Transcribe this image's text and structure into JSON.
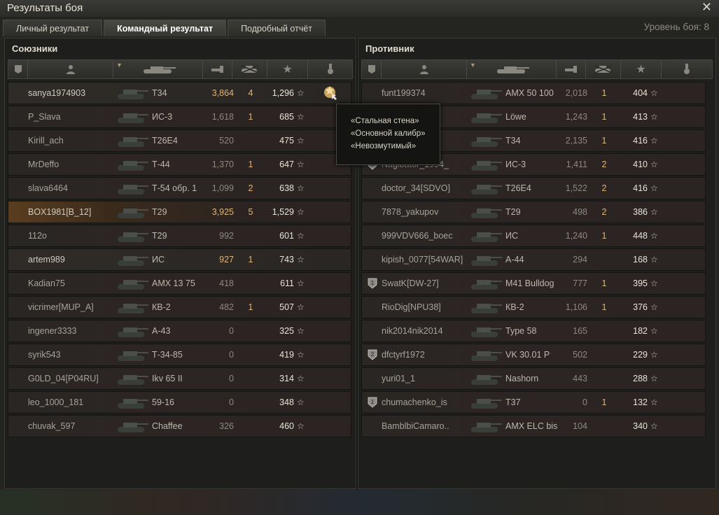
{
  "window": {
    "title": "Результаты боя",
    "close_icon": "close-icon"
  },
  "tabs": [
    {
      "label": "Личный результат",
      "active": false
    },
    {
      "label": "Командный результат",
      "active": true
    },
    {
      "label": "Подробный отчёт",
      "active": false
    }
  ],
  "battle_level": "Уровень боя: 8",
  "allies": {
    "title": "Союзники",
    "rows": [
      {
        "name": "sanya1974903",
        "vehicle": "T34",
        "damage": "3,864",
        "kills": "4",
        "xp": "1,296",
        "damage_hi": true,
        "style": "top"
      },
      {
        "name": "P_Slava",
        "vehicle": "ИС-3",
        "damage": "1,618",
        "kills": "1",
        "xp": "685",
        "damage_hi": false,
        "style": "dim"
      },
      {
        "name": "Kirill_ach",
        "vehicle": "T26E4",
        "damage": "520",
        "kills": "",
        "xp": "475",
        "damage_hi": false,
        "style": "dim"
      },
      {
        "name": "MrDeffo",
        "vehicle": "Т-44",
        "damage": "1,370",
        "kills": "1",
        "xp": "647",
        "damage_hi": false,
        "style": "dim"
      },
      {
        "name": "slava6464",
        "vehicle": "Т-54 обр. 1",
        "damage": "1,099",
        "kills": "2",
        "xp": "638",
        "damage_hi": false,
        "style": "dim"
      },
      {
        "name": "BOX1981[B_12]",
        "vehicle": "T29",
        "damage": "3,925",
        "kills": "5",
        "xp": "1,529",
        "damage_hi": true,
        "style": "me"
      },
      {
        "name": "112o",
        "vehicle": "T29",
        "damage": "992",
        "kills": "",
        "xp": "601",
        "damage_hi": false,
        "style": "dim"
      },
      {
        "name": "artem989",
        "vehicle": "ИС",
        "damage": "927",
        "kills": "1",
        "xp": "743",
        "damage_hi": true,
        "style": "top"
      },
      {
        "name": "Kadian75",
        "vehicle": "AMX 13 75",
        "damage": "418",
        "kills": "",
        "xp": "611",
        "damage_hi": false,
        "style": "dim"
      },
      {
        "name": "vicrimer[MUP_A]",
        "vehicle": "КВ-2",
        "damage": "482",
        "kills": "1",
        "xp": "507",
        "damage_hi": false,
        "style": "dim"
      },
      {
        "name": "ingener3333",
        "vehicle": "А-43",
        "damage": "0",
        "kills": "",
        "xp": "325",
        "damage_hi": false,
        "style": "dim"
      },
      {
        "name": "syrik543",
        "vehicle": "Т-34-85",
        "damage": "0",
        "kills": "",
        "xp": "419",
        "damage_hi": false,
        "style": "dim"
      },
      {
        "name": "G0LD_04[P04RU]",
        "vehicle": "Ikv 65 II",
        "damage": "0",
        "kills": "",
        "xp": "314",
        "damage_hi": false,
        "style": "dim"
      },
      {
        "name": "leo_1000_181",
        "vehicle": "59-16",
        "damage": "0",
        "kills": "",
        "xp": "348",
        "damage_hi": false,
        "style": "dim"
      },
      {
        "name": "chuvak_597",
        "vehicle": "Chaffee",
        "damage": "326",
        "kills": "",
        "xp": "460",
        "damage_hi": false,
        "style": "dim"
      }
    ]
  },
  "enemies": {
    "title": "Противник",
    "rows": [
      {
        "badge": "",
        "name": "funt199374",
        "vehicle": "AMX 50 100",
        "damage": "2,018",
        "kills": "1",
        "xp": "404"
      },
      {
        "badge": "",
        "name": "",
        "vehicle": "Löwe",
        "damage": "1,243",
        "kills": "1",
        "xp": "413"
      },
      {
        "badge": "",
        "name": "RBC]",
        "vehicle": "T34",
        "damage": "2,135",
        "kills": "1",
        "xp": "416"
      },
      {
        "badge": "2",
        "name": "Nagibator_1994_",
        "vehicle": "ИС-3",
        "damage": "1,411",
        "kills": "2",
        "xp": "410"
      },
      {
        "badge": "",
        "name": "doctor_34[SDVO]",
        "vehicle": "T26E4",
        "damage": "1,522",
        "kills": "2",
        "xp": "416"
      },
      {
        "badge": "",
        "name": "7878_yakupov",
        "vehicle": "T29",
        "damage": "498",
        "kills": "2",
        "xp": "386"
      },
      {
        "badge": "",
        "name": "999VDV666_boec",
        "vehicle": "ИС",
        "damage": "1,240",
        "kills": "1",
        "xp": "448"
      },
      {
        "badge": "",
        "name": "kipish_0077[54WAR]",
        "vehicle": "А-44",
        "damage": "294",
        "kills": "",
        "xp": "168"
      },
      {
        "badge": "1",
        "name": "SwatK[DW-27]",
        "vehicle": "M41 Bulldog",
        "damage": "777",
        "kills": "1",
        "xp": "395"
      },
      {
        "badge": "",
        "name": "RioDig[NPU38]",
        "vehicle": "КВ-2",
        "damage": "1,106",
        "kills": "1",
        "xp": "376"
      },
      {
        "badge": "",
        "name": "nik2014nik2014",
        "vehicle": "Type 58",
        "damage": "165",
        "kills": "",
        "xp": "182"
      },
      {
        "badge": "2",
        "name": "dfctyrf1972",
        "vehicle": "VK 30.01 P",
        "damage": "502",
        "kills": "",
        "xp": "229"
      },
      {
        "badge": "",
        "name": "yuri01_1",
        "vehicle": "Nashorn",
        "damage": "443",
        "kills": "",
        "xp": "288"
      },
      {
        "badge": "1",
        "name": "chumachenko_is",
        "vehicle": "T37",
        "damage": "0",
        "kills": "1",
        "xp": "132"
      },
      {
        "badge": "",
        "name": "BamblbiCamaro..",
        "vehicle": "AMX ELC bis",
        "damage": "104",
        "kills": "",
        "xp": "340"
      }
    ]
  },
  "tooltip": {
    "lines": [
      "«Стальная стена»",
      "«Основной калибр»",
      "«Невозмутимый»"
    ]
  },
  "header_icons": [
    "badge-icon",
    "player-icon",
    "tank-icon",
    "damage-icon",
    "kills-icon",
    "xp-star-icon",
    "medal-icon"
  ]
}
